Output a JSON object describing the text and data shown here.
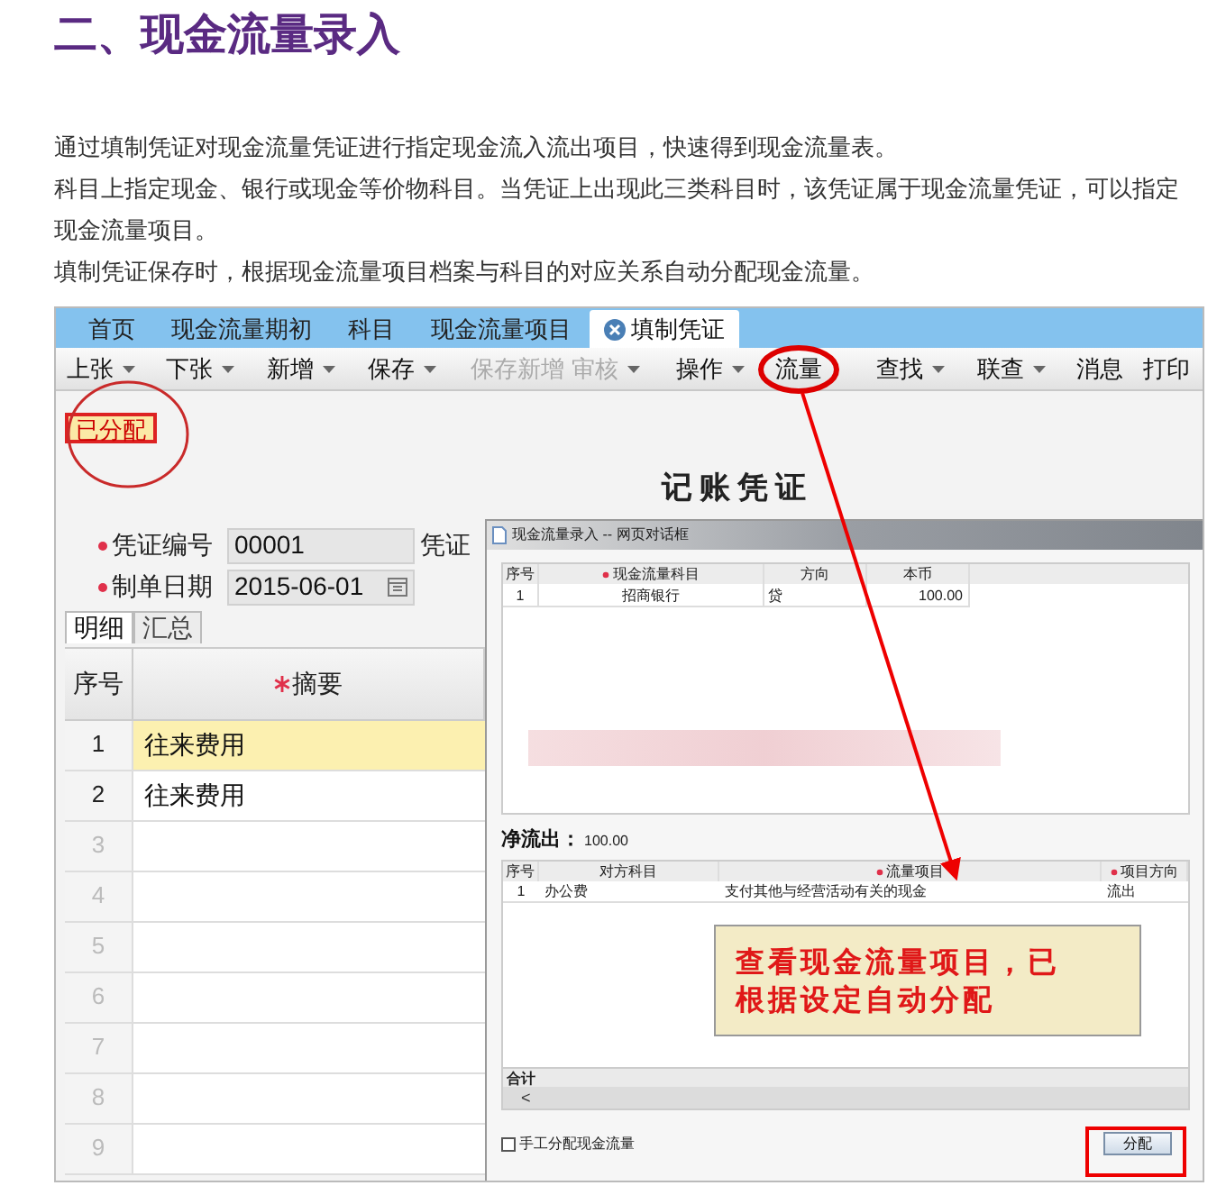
{
  "heading": "二、现金流量录入",
  "paragraphs": [
    "通过填制凭证对现金流量凭证进行指定现金流入流出项目，快速得到现金流量表。",
    "科目上指定现金、银行或现金等价物科目。当凭证上出现此三类科目时，该凭证属于现金流量凭证，可以指定现金流量项目。",
    "填制凭证保存时，根据现金流量项目档案与科目的对应关系自动分配现金流量。"
  ],
  "app": {
    "tabs": [
      {
        "label": "首页",
        "selected": false
      },
      {
        "label": "现金流量期初",
        "selected": false
      },
      {
        "label": "科目",
        "selected": false
      },
      {
        "label": "现金流量项目",
        "selected": false
      },
      {
        "label": "填制凭证",
        "selected": true
      }
    ],
    "toolbar": [
      {
        "label": "上张",
        "dropdown": true,
        "disabled": false
      },
      {
        "label": "下张",
        "dropdown": true,
        "disabled": false
      },
      {
        "label": "新增",
        "dropdown": true,
        "disabled": false
      },
      {
        "label": "保存",
        "dropdown": true,
        "disabled": false
      },
      {
        "label": "保存新增",
        "dropdown": false,
        "disabled": true
      },
      {
        "label": "审核",
        "dropdown": true,
        "disabled": true
      },
      {
        "label": "操作",
        "dropdown": true,
        "disabled": false
      },
      {
        "label": "流量",
        "dropdown": false,
        "disabled": false
      },
      {
        "label": "查找",
        "dropdown": true,
        "disabled": false
      },
      {
        "label": "联查",
        "dropdown": true,
        "disabled": false
      },
      {
        "label": "消息",
        "dropdown": false,
        "disabled": false
      },
      {
        "label": "打印",
        "dropdown": false,
        "disabled": false
      }
    ],
    "status_badge": "已分配",
    "voucher_title": "记账凭证",
    "fields": [
      {
        "label": "凭证编号",
        "value": "00001",
        "kind": "text",
        "required": true
      },
      {
        "label": "制单日期",
        "value": "2015-06-01",
        "kind": "date",
        "required": true
      }
    ],
    "partial_label": "凭证",
    "detail_tabs": [
      {
        "label": "明细",
        "selected": true
      },
      {
        "label": "汇总",
        "selected": false
      }
    ],
    "grid": {
      "columns": [
        {
          "label": "序号",
          "required": false
        },
        {
          "label": "摘要",
          "required": true
        }
      ],
      "rows": [
        {
          "number": "1",
          "summary": "往来费用",
          "selected": true
        },
        {
          "number": "2",
          "summary": "往来费用",
          "selected": false
        },
        {
          "number": "3",
          "summary": "",
          "selected": false
        },
        {
          "number": "4",
          "summary": "",
          "selected": false
        },
        {
          "number": "5",
          "summary": "",
          "selected": false
        },
        {
          "number": "6",
          "summary": "",
          "selected": false
        },
        {
          "number": "7",
          "summary": "",
          "selected": false
        },
        {
          "number": "8",
          "summary": "",
          "selected": false
        },
        {
          "number": "9",
          "summary": "",
          "selected": false
        }
      ]
    }
  },
  "dialog": {
    "title": "现金流量录入 -- 网页对话框",
    "top_table": {
      "columns": [
        {
          "label": "序号",
          "required": false
        },
        {
          "label": "现金流量科目",
          "required": true
        },
        {
          "label": "方向",
          "required": false
        },
        {
          "label": "本币",
          "required": false
        }
      ],
      "rows": [
        [
          "1",
          "招商银行",
          "贷",
          "100.00"
        ]
      ]
    },
    "net_label": "净流出：",
    "net_value": "100.00",
    "bottom_table": {
      "columns": [
        {
          "label": "序号",
          "required": false
        },
        {
          "label": "对方科目",
          "required": false
        },
        {
          "label": "流量项目",
          "required": true
        },
        {
          "label": "项目方向",
          "required": true
        }
      ],
      "rows": [
        [
          "1",
          "办公费",
          "支付其他与经营活动有关的现金",
          "流出"
        ]
      ],
      "total_label": "合计",
      "scroll_left": "<"
    },
    "manual_checkbox": {
      "label": "手工分配现金流量",
      "checked": false
    },
    "assign_button": "分配"
  },
  "callout": [
    "查看现金流量项目，已",
    "根据设定自动分配"
  ]
}
